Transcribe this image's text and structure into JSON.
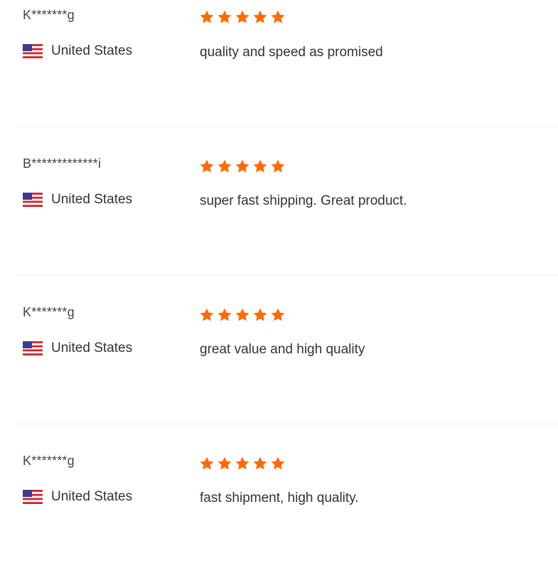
{
  "colors": {
    "star": "#ff6a00",
    "text": "#333333",
    "divider": "#efefef"
  },
  "icons": {
    "flag": "us-flag-icon",
    "star": "star-icon"
  },
  "reviews": [
    {
      "username": "K*******g",
      "country": "United States",
      "rating": 5,
      "comment": "quality and speed as promised"
    },
    {
      "username": "B*************i",
      "country": "United States",
      "rating": 5,
      "comment": "super fast shipping. Great product."
    },
    {
      "username": "K*******g",
      "country": "United States",
      "rating": 5,
      "comment": "great value and high quality"
    },
    {
      "username": "K*******g",
      "country": "United States",
      "rating": 5,
      "comment": "fast shipment, high quality."
    }
  ]
}
